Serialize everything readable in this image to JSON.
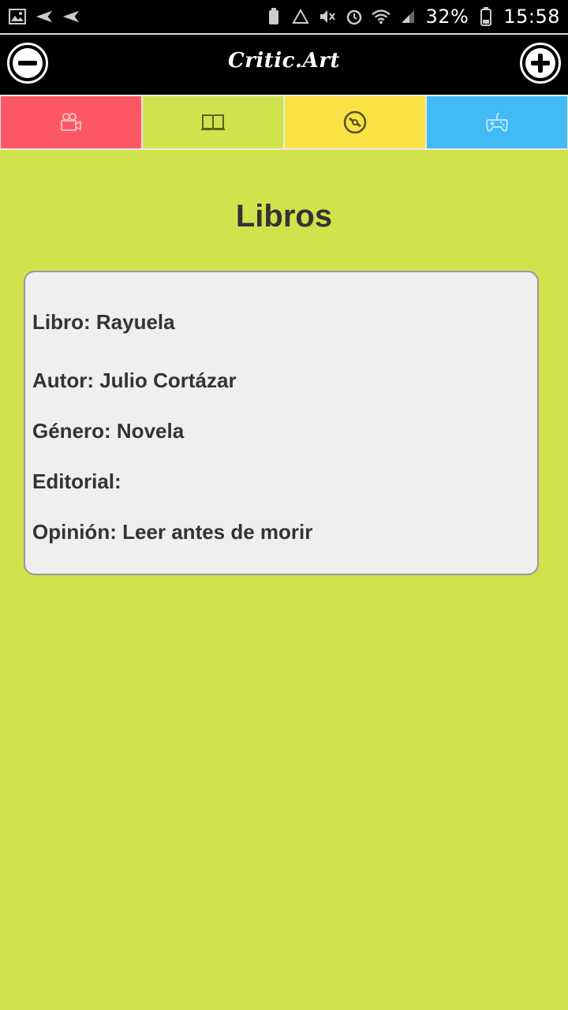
{
  "status_bar": {
    "battery": "32%",
    "time": "15:58"
  },
  "header": {
    "title": "Critic.Art",
    "left_action": "minus-icon",
    "right_action": "plus-icon"
  },
  "tabs": [
    {
      "icon": "video-camera-icon",
      "color": "#fd5765"
    },
    {
      "icon": "book-icon",
      "color": "#d1e34c"
    },
    {
      "icon": "disc-icon",
      "color": "#fbe244"
    },
    {
      "icon": "gamepad-icon",
      "color": "#42bbf5"
    }
  ],
  "page": {
    "title": "Libros"
  },
  "card": {
    "libro": "Libro: Rayuela",
    "autor": "Autor: Julio Cortázar",
    "genero": "Género: Novela",
    "editorial": "Editorial:",
    "opinion": "Opinión: Leer antes de morir"
  }
}
